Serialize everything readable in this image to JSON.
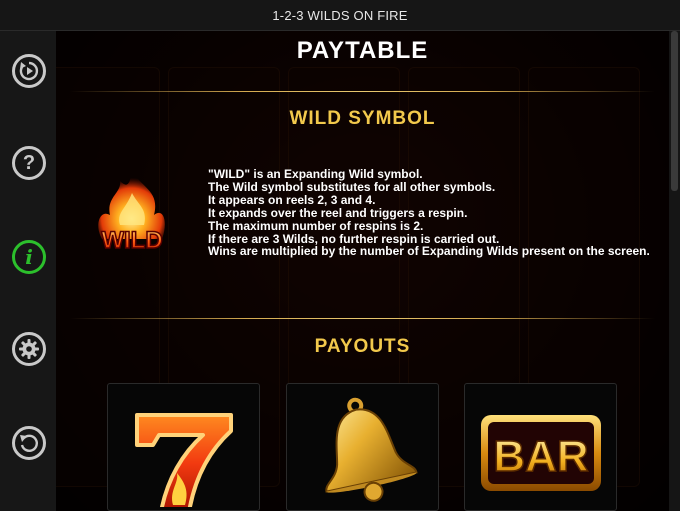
{
  "window": {
    "title": "1-2-3 WILDS ON FIRE"
  },
  "sidebar": {
    "items": [
      {
        "name": "autoplay",
        "icon": "replay-play-icon"
      },
      {
        "name": "help",
        "icon": "question-icon"
      },
      {
        "name": "info",
        "icon": "info-icon",
        "active": true
      },
      {
        "name": "settings",
        "icon": "gear-icon"
      },
      {
        "name": "back",
        "icon": "back-arrow-icon"
      }
    ]
  },
  "paytable": {
    "title": "PAYTABLE",
    "wild_section": {
      "heading": "WILD SYMBOL",
      "symbol_label": "WILD",
      "lines": [
        "\"WILD\" is an Expanding Wild symbol.",
        "The Wild symbol substitutes for all other symbols.",
        "It appears on reels 2, 3 and 4.",
        "It expands over the reel and triggers a respin.",
        "The maximum number of respins is 2.",
        "If there are 3 Wilds, no further respin is carried out.",
        "Wins are multiplied by the number of Expanding Wilds present on the screen."
      ]
    },
    "payouts_section": {
      "heading": "PAYOUTS",
      "symbols": [
        {
          "name": "seven",
          "icon": "lucky-seven-icon"
        },
        {
          "name": "bell",
          "icon": "bell-icon"
        },
        {
          "name": "bar",
          "icon": "bar-icon",
          "label": "BAR"
        }
      ]
    }
  },
  "colors": {
    "accent_gold": "#f2c94c",
    "active_green": "#2cc02c",
    "sidebar_bg": "#171717"
  }
}
